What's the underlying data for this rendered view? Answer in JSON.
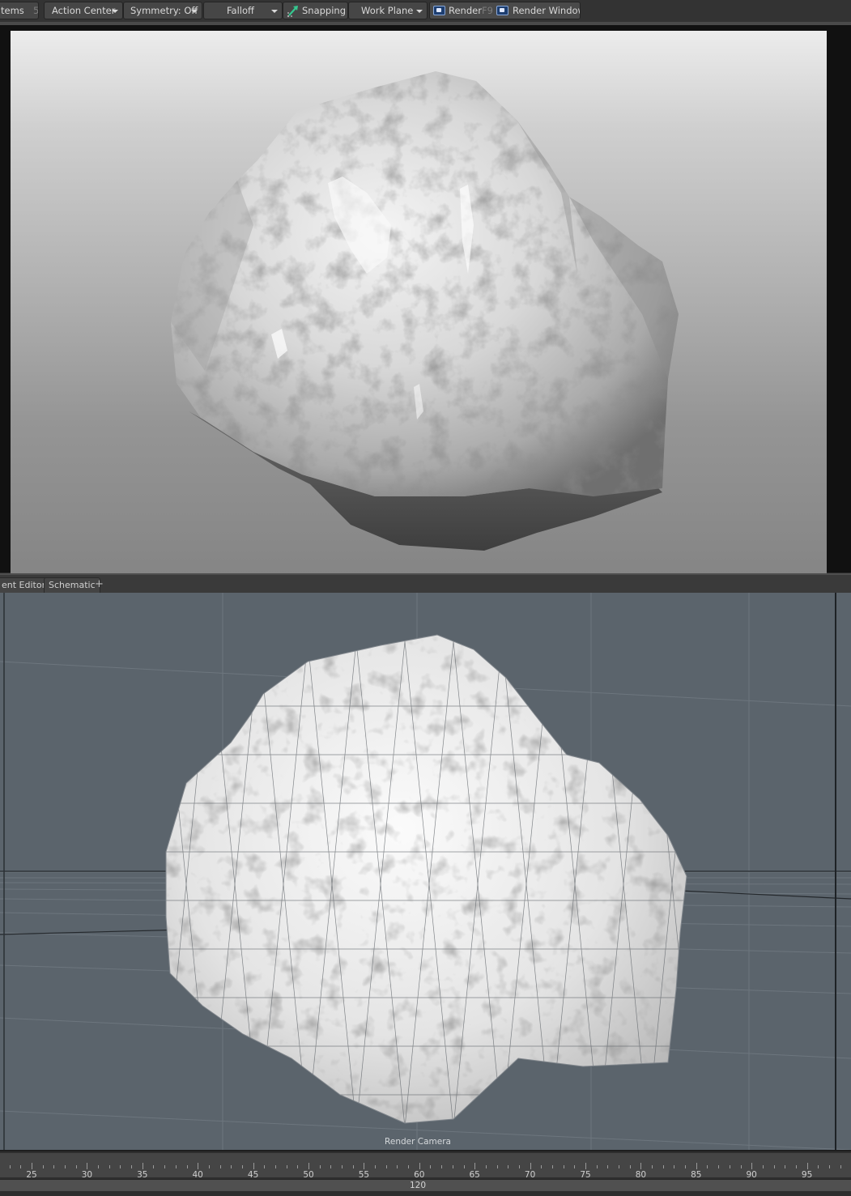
{
  "toolbar": {
    "items_label": "tems",
    "items_shortcut": "5",
    "action_center": "Action Center",
    "symmetry": "Symmetry: Off",
    "falloff": "Falloff",
    "snapping": "Snapping",
    "work_plane": "Work Plane",
    "render": "Render",
    "render_shortcut": "F9",
    "render_window": "Render Window"
  },
  "tabs": {
    "editor": "ent Editor",
    "schematic": "Schematic",
    "add": "+"
  },
  "viewport": {
    "caption": "Render Camera"
  },
  "timeline": {
    "ticks": [
      "25",
      "30",
      "35",
      "40",
      "45",
      "50",
      "55",
      "60",
      "65",
      "70",
      "75",
      "80",
      "85",
      "90",
      "95"
    ],
    "current_frame": "120"
  },
  "colors": {
    "toolbar_bg": "#333333",
    "button_bg": "#464646",
    "viewport_bg": "#5b646c",
    "snapping_icon": "#35c890",
    "render_icon": "#1d3e70"
  }
}
